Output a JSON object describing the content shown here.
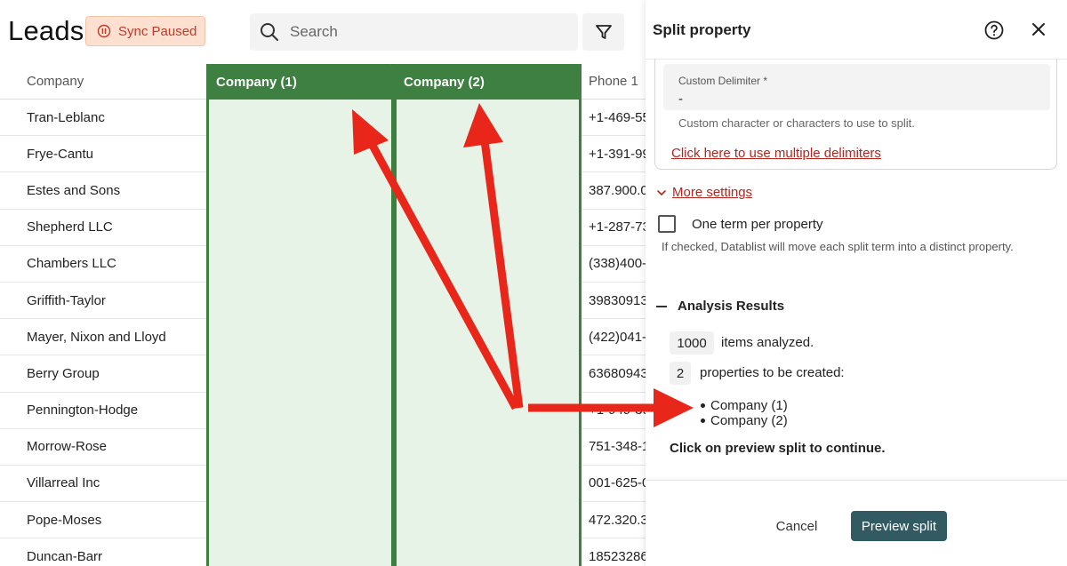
{
  "app": {
    "title": "Leads",
    "sync_label": "Sync Paused",
    "search_placeholder": "Search"
  },
  "table": {
    "columns": [
      "Company",
      "Company (1)",
      "Company (2)",
      "Phone 1"
    ],
    "companies": [
      "Tran-Leblanc",
      "Frye-Cantu",
      "Estes and Sons",
      "Shepherd LLC",
      "Chambers LLC",
      "Griffith-Taylor",
      "Mayer, Nixon and Lloyd",
      "Berry Group",
      "Pennington-Hodge",
      "Morrow-Rose",
      "Villarreal Inc",
      "Pope-Moses",
      "Duncan-Barr"
    ],
    "phones": [
      "+1-469-55",
      "+1-391-99",
      "387.900.0",
      "+1-287-73",
      "(338)400-",
      "39830913",
      "(422)041-",
      "63680943",
      "+1-949-39",
      "751-348-1",
      "001-625-0",
      "472.320.3",
      "18523286"
    ]
  },
  "panel": {
    "title": "Split property",
    "delimiter_label": "Custom Delimiter *",
    "delimiter_value": "-",
    "delimiter_help": "Custom character or characters to use to split.",
    "multiple_delimiters_link": "Click here to use multiple delimiters",
    "more_settings": "More settings",
    "one_term_label": "One term per property",
    "one_term_checked": false,
    "one_term_help": "If checked, Datablist will move each split term into a distinct property.",
    "analysis_title": "Analysis Results",
    "items_count": "1000",
    "items_text": "items analyzed.",
    "props_count": "2",
    "props_text": "properties to be created:",
    "new_properties": [
      "Company (1)",
      "Company (2)"
    ],
    "continue_text": "Click on preview split to continue.",
    "cancel_label": "Cancel",
    "preview_label": "Preview split"
  },
  "colors": {
    "new_column_header": "#3e7f42",
    "new_column_fill": "#e8f3e8",
    "sync_badge_bg": "#fde0cf",
    "sync_badge_text": "#c0392b",
    "link": "#b3261e",
    "primary_button": "#315a63",
    "annotation_arrow": "#e8261a"
  },
  "icons": [
    "pause-circle-icon",
    "search-icon",
    "filter-icon",
    "help-circle-icon",
    "close-icon",
    "chevron-down-icon",
    "minus-icon"
  ]
}
